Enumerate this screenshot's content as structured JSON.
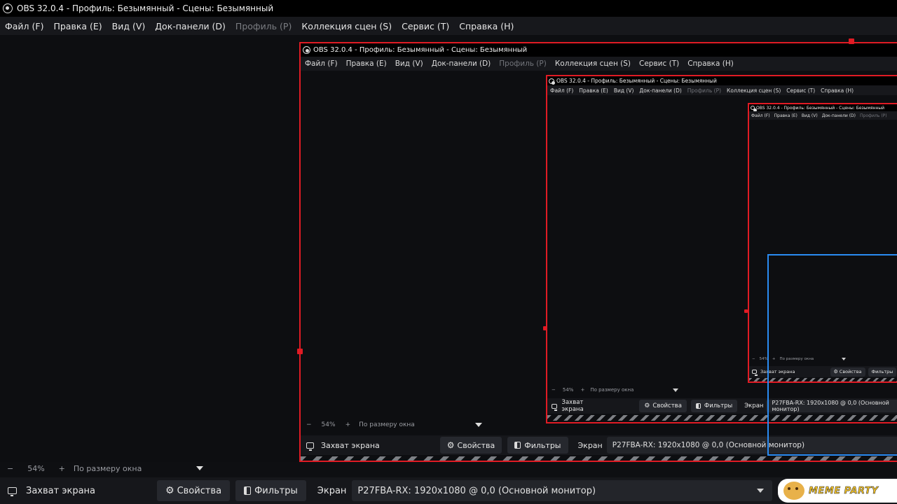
{
  "window": {
    "title": "OBS 32.0.4 - Профиль: Безымянный - Сцены: Безымянный"
  },
  "menu": [
    {
      "label": "Файл (F)",
      "disabled": false
    },
    {
      "label": "Правка (E)",
      "disabled": false
    },
    {
      "label": "Вид (V)",
      "disabled": false
    },
    {
      "label": "Док-панели (D)",
      "disabled": false
    },
    {
      "label": "Профиль (P)",
      "disabled": true
    },
    {
      "label": "Коллекция сцен (S)",
      "disabled": false
    },
    {
      "label": "Сервис (T)",
      "disabled": false
    },
    {
      "label": "Справка (H)",
      "disabled": false
    }
  ],
  "menu_labels": {
    "file": "Файл (F)",
    "edit": "Правка (E)",
    "view": "Вид (V)",
    "docks": "Док-панели (D)",
    "profile": "Профиль (P)",
    "scene_collection": "Коллекция сцен (S)",
    "tools": "Сервис (T)",
    "help": "Справка (H)"
  },
  "zoom": {
    "minus": "−",
    "level": "54%",
    "plus": "+",
    "fit_label": "По размеру окна"
  },
  "source_bar": {
    "source_name": "Захват экрана",
    "properties_label": "Свойства",
    "filters_label": "Фильтры",
    "screen_label": "Экран",
    "screen_value": "P27FBA-RX: 1920x1080 @ 0,0 (Основной монитор)",
    "screen_value_nested": "P27FBA-RX: 1920x1080 @ 0,0 (Основной монитор)"
  },
  "watermark": {
    "text": "MEME PARTY"
  },
  "colors": {
    "selection_red": "#e01b24",
    "selection_blue": "#2a8bf2",
    "background": "#0e0f12"
  }
}
